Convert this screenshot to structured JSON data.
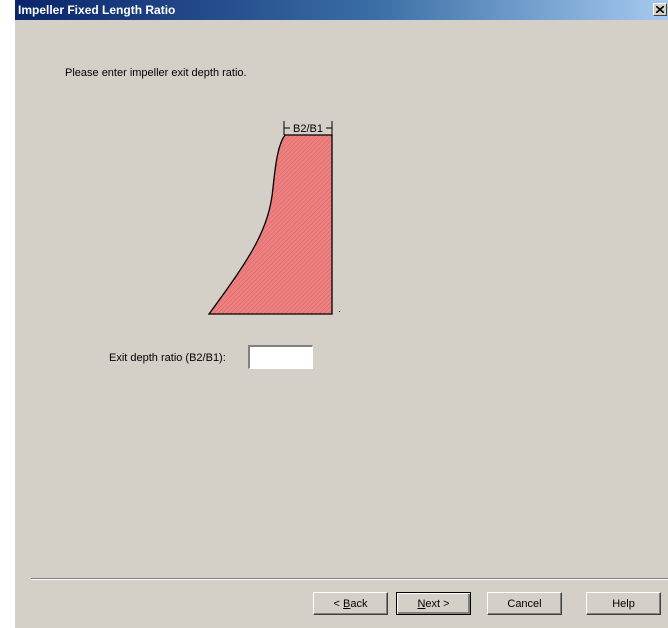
{
  "window": {
    "title": "Impeller Fixed Length Ratio",
    "close_icon": "close-icon"
  },
  "prompt": "Please enter impeller exit depth ratio.",
  "diagram": {
    "label": "B2/B1",
    "fill_color": "#f08080",
    "hatch_color": "#c06060"
  },
  "ratio_field": {
    "label": "Exit depth ratio (B2/B1):",
    "value": ""
  },
  "buttons": {
    "back": {
      "prefix": "< ",
      "mnemonic": "B",
      "rest": "ack"
    },
    "next": {
      "mnemonic": "N",
      "rest": "ext",
      "suffix": " >"
    },
    "cancel": "Cancel",
    "help": "Help"
  }
}
